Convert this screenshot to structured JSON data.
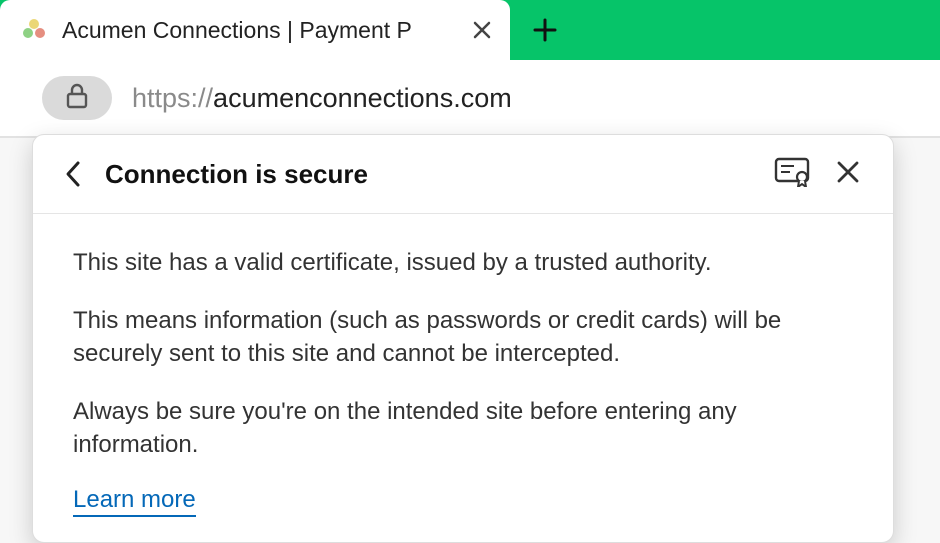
{
  "tab": {
    "title": "Acumen Connections | Payment P"
  },
  "address_bar": {
    "scheme": "https://",
    "host": "acumenconnections.com"
  },
  "popover": {
    "title": "Connection is secure",
    "para1": "This site has a valid certificate, issued by a trusted authority.",
    "para2": "This means information (such as passwords or credit cards) will be securely sent to this site and cannot be intercepted.",
    "para3": "Always be sure you're on the intended site before entering any information.",
    "learn_more": "Learn more"
  }
}
